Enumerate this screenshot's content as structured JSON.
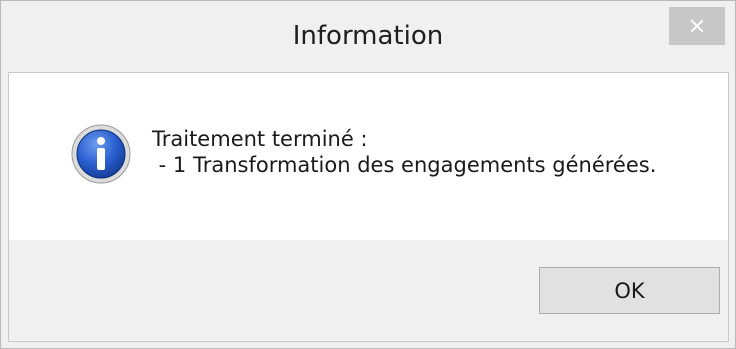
{
  "window": {
    "title": "Information",
    "close_icon": "close-icon"
  },
  "message": {
    "icon": "info-icon",
    "line1": "Traitement terminé :",
    "line2": " - 1 Transformation des engagements générées."
  },
  "buttons": {
    "ok_label": "OK"
  },
  "colors": {
    "titlebar_bg": "#f0f0f0",
    "close_button_bg": "#c7c7c7",
    "message_bg": "#ffffff",
    "info_icon_blue": "#1c4fb8"
  }
}
